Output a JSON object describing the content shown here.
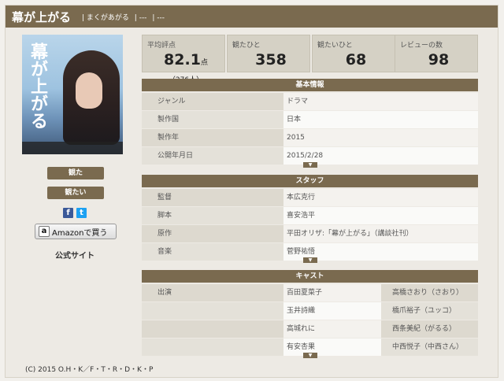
{
  "header": {
    "title": "幕が上がる",
    "subtitle": "| まくがあがる",
    "sep1": "| ---",
    "sep2": "| ---"
  },
  "poster": {
    "title_text": "幕が上がる"
  },
  "actions": {
    "watched": "観た",
    "want": "観たい",
    "fb": "f",
    "tw": "t",
    "amazon_logo": "a",
    "amazon_label": "Amazonで買う",
    "official": "公式サイト"
  },
  "stats": [
    {
      "label": "平均評点",
      "value": "82.1",
      "unit": "点",
      "extra": "（276人）"
    },
    {
      "label": "観たひと",
      "value": "358"
    },
    {
      "label": "観たいひと",
      "value": "68"
    },
    {
      "label": "レビューの数",
      "value": "98"
    }
  ],
  "basic": {
    "heading": "基本情報",
    "rows": [
      {
        "k": "ジャンル",
        "v": "ドラマ"
      },
      {
        "k": "製作国",
        "v": "日本"
      },
      {
        "k": "製作年",
        "v": "2015"
      },
      {
        "k": "公開年月日",
        "v": "2015/2/28"
      }
    ]
  },
  "staff": {
    "heading": "スタッフ",
    "rows": [
      {
        "k": "監督",
        "v": "本広克行"
      },
      {
        "k": "脚本",
        "v": "喜安浩平"
      },
      {
        "k": "原作",
        "v": "平田オリザ:「幕が上がる」（講談社刊）"
      },
      {
        "k": "音楽",
        "v": "菅野祐悟"
      }
    ]
  },
  "cast": {
    "heading": "キャスト",
    "label": "出演",
    "rows": [
      {
        "a": "百田夏菜子",
        "b": "高橋さおり（さおり）"
      },
      {
        "a": "玉井詩織",
        "b": "橋爪裕子（ユッコ）"
      },
      {
        "a": "高城れに",
        "b": "西条美紀（がるる）"
      },
      {
        "a": "有安杏果",
        "b": "中西悦子（中西さん）"
      }
    ]
  },
  "more_glyph": "▼",
  "copyright": "(C)  2015 O.H・K／F・T・R・D・K・P"
}
